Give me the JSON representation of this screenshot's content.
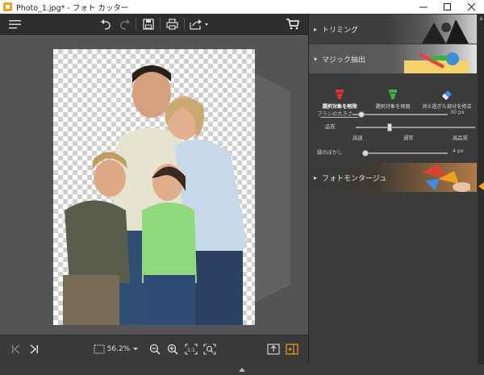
{
  "window": {
    "title": "Photo_1.jpg* - フォト カッター"
  },
  "toolbar": {
    "menu_icon": "hamburger-icon",
    "undo": "undo-icon",
    "redo": "redo-icon",
    "save": "save-icon",
    "print": "print-icon",
    "share": "share-icon",
    "cart": "cart-icon"
  },
  "panel": {
    "sections": [
      {
        "label": "トリミング",
        "expanded": false
      },
      {
        "label": "マジック抽出",
        "expanded": true
      },
      {
        "label": "フォトモンタージュ",
        "expanded": false
      }
    ],
    "tools": [
      {
        "label": "選択対象を削除",
        "active": true,
        "color": "#e03030"
      },
      {
        "label": "選択対象を保留",
        "active": false,
        "color": "#3cb043"
      },
      {
        "label": "消え過ぎた部分を修正",
        "active": false,
        "color": "#3a8ee6"
      }
    ],
    "brush": {
      "label": "ブラシの大きさ",
      "value": "30 px",
      "level": 0.08
    },
    "quality": {
      "label": "品質",
      "options": [
        "高速",
        "通常",
        "高品質"
      ],
      "level": 0.2
    },
    "edge": {
      "label": "縁のぼかし",
      "value": "4 px",
      "level": 0.02
    }
  },
  "bottombar": {
    "zoom": "56.2%"
  },
  "colors": {
    "accent": "#f0a01e",
    "panel": "#3b3b3b",
    "canvas": "#545454"
  }
}
